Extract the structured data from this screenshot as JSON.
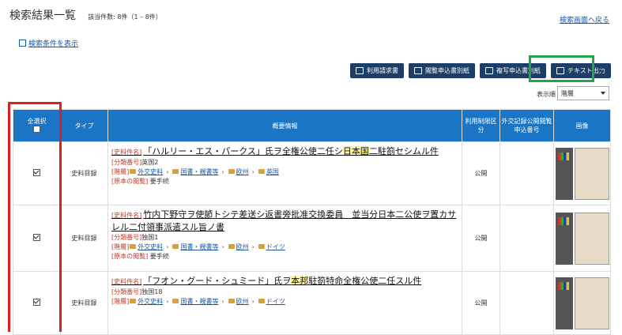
{
  "header": {
    "title": "検索結果一覧",
    "count": "該当件数: 8件（1 – 8件）",
    "back_link": "検索画面へ戻る",
    "show_conditions": "検索条件を表示"
  },
  "toolbar": {
    "buttons": [
      {
        "label": "利用請求書"
      },
      {
        "label": "閲覧申込書別紙"
      },
      {
        "label": "複写申込書別紙"
      },
      {
        "label": "テキスト出力"
      }
    ],
    "help": "?"
  },
  "sort": {
    "label": "表示順",
    "value": "階層"
  },
  "table": {
    "headers": {
      "select_all": "全選択",
      "type": "タイプ",
      "summary": "概要情報",
      "restriction": "利用制限区分",
      "foreign": "外交記録公開閲覧申込番号",
      "image": "画像"
    },
    "rows": [
      {
        "type": "史料目録",
        "title_prefix": "[史料件名]",
        "title_a": "「ハルリー・エス・パークス」氏ヲ全権公使二任シ",
        "title_hl": "日本国",
        "title_b": "二駐箚セシムル件",
        "class_label": "[分類番号]",
        "class_value": "英国2",
        "tier_label": "[階層]",
        "crumbs": [
          "外交史料",
          "国書・親書等",
          "欧州",
          "英国"
        ],
        "original_label": "[原本の閲覧]",
        "original_value": "要手続",
        "restriction": "公開"
      },
      {
        "type": "史料目録",
        "title_prefix": "[史料件名]",
        "title_a": "竹内下野守ヲ使節トシテ差送シ返書旁批准交換委員　並当分日本二公使ヲ置カサレル二付領事派遣スル旨ノ書",
        "title_hl": "",
        "title_b": "",
        "class_label": "[分類番号]",
        "class_value": "独国1",
        "tier_label": "[階層]",
        "crumbs": [
          "外交史料",
          "国書・親書等",
          "欧州",
          "ドイツ"
        ],
        "original_label": "[原本の閲覧]",
        "original_value": "要手続",
        "restriction": "公開"
      },
      {
        "type": "史料目録",
        "title_prefix": "[史料件名]",
        "title_a": "「フオン・グード・シュミード」氏ヲ",
        "title_hl": "本邦",
        "title_b": "駐箚特命全権公使二任スル件",
        "class_label": "[分類番号]",
        "class_value": "独国18",
        "tier_label": "[階層]",
        "crumbs": [
          "外交史料",
          "国書・親書等",
          "欧州",
          "ドイツ"
        ],
        "original_label": "",
        "original_value": "",
        "restriction": "公開"
      }
    ]
  }
}
